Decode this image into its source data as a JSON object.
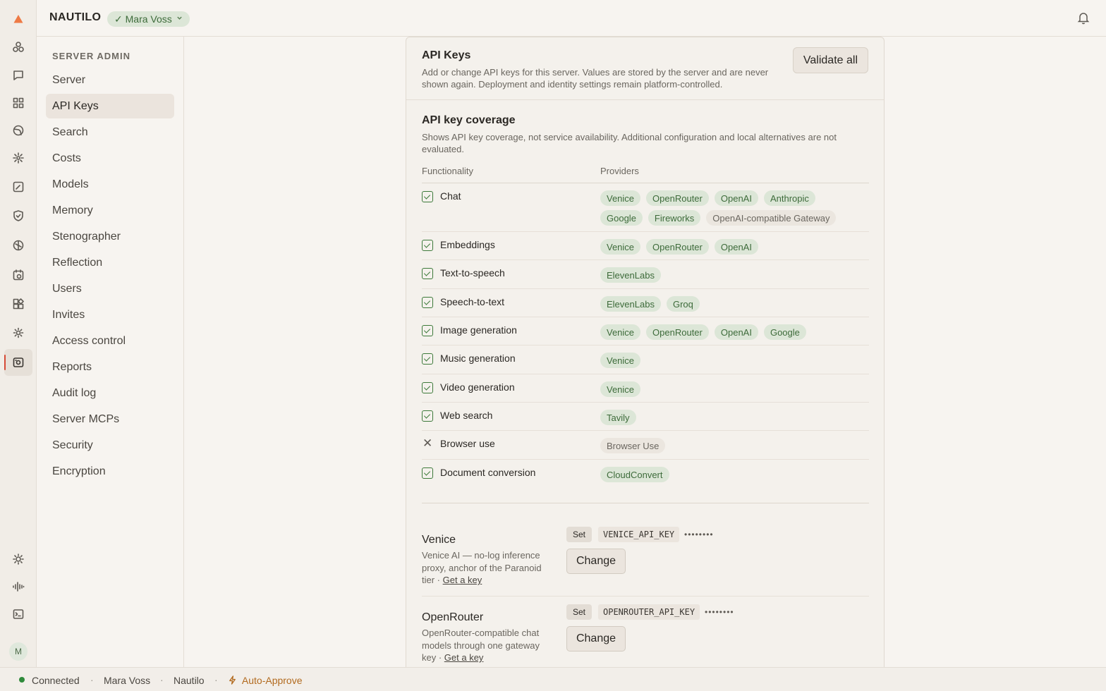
{
  "app": {
    "brand": "NAUTILO",
    "user_pill": "✓ Mara Voss",
    "avatar_initial": "M"
  },
  "rail_icons": [
    "logo-icon",
    "integrations-icon",
    "chat-icon",
    "apps-grid-icon",
    "globe-icon",
    "sparkle-icon",
    "edit-icon",
    "shield-icon",
    "brain-icon",
    "schedule-icon",
    "widgets-icon",
    "settings-icon",
    "server-admin-icon",
    "theme-icon",
    "audio-icon",
    "terminal-icon"
  ],
  "sidebar": {
    "title": "SERVER ADMIN",
    "items": [
      {
        "label": "Server"
      },
      {
        "label": "API Keys"
      },
      {
        "label": "Search"
      },
      {
        "label": "Costs"
      },
      {
        "label": "Models"
      },
      {
        "label": "Memory"
      },
      {
        "label": "Stenographer"
      },
      {
        "label": "Reflection"
      },
      {
        "label": "Users"
      },
      {
        "label": "Invites"
      },
      {
        "label": "Access control"
      },
      {
        "label": "Reports"
      },
      {
        "label": "Audit log"
      },
      {
        "label": "Server MCPs"
      },
      {
        "label": "Security"
      },
      {
        "label": "Encryption"
      }
    ],
    "active_index": 1
  },
  "panel": {
    "title": "API Keys",
    "description": "Add or change API keys for this server. Values are stored by the server and are never shown again. Deployment and identity settings remain platform-controlled.",
    "validate_label": "Validate all",
    "coverage_title": "API key coverage",
    "coverage_desc": "Shows API key coverage, not service availability. Additional configuration and local alternatives are not evaluated.",
    "col_functionality": "Functionality",
    "col_providers": "Providers",
    "rows": [
      {
        "name": "Chat",
        "covered": true,
        "providers": [
          {
            "n": "Venice",
            "on": true
          },
          {
            "n": "OpenRouter",
            "on": true
          },
          {
            "n": "OpenAI",
            "on": true
          },
          {
            "n": "Anthropic",
            "on": true
          },
          {
            "n": "Google",
            "on": true
          },
          {
            "n": "Fireworks",
            "on": true
          },
          {
            "n": "OpenAI-compatible Gateway",
            "on": false
          }
        ]
      },
      {
        "name": "Embeddings",
        "covered": true,
        "providers": [
          {
            "n": "Venice",
            "on": true
          },
          {
            "n": "OpenRouter",
            "on": true
          },
          {
            "n": "OpenAI",
            "on": true
          }
        ]
      },
      {
        "name": "Text-to-speech",
        "covered": true,
        "providers": [
          {
            "n": "ElevenLabs",
            "on": true
          }
        ]
      },
      {
        "name": "Speech-to-text",
        "covered": true,
        "providers": [
          {
            "n": "ElevenLabs",
            "on": true
          },
          {
            "n": "Groq",
            "on": true
          }
        ]
      },
      {
        "name": "Image generation",
        "covered": true,
        "providers": [
          {
            "n": "Venice",
            "on": true
          },
          {
            "n": "OpenRouter",
            "on": true
          },
          {
            "n": "OpenAI",
            "on": true
          },
          {
            "n": "Google",
            "on": true
          }
        ]
      },
      {
        "name": "Music generation",
        "covered": true,
        "providers": [
          {
            "n": "Venice",
            "on": true
          }
        ]
      },
      {
        "name": "Video generation",
        "covered": true,
        "providers": [
          {
            "n": "Venice",
            "on": true
          }
        ]
      },
      {
        "name": "Web search",
        "covered": true,
        "providers": [
          {
            "n": "Tavily",
            "on": true
          }
        ]
      },
      {
        "name": "Browser use",
        "covered": false,
        "providers": [
          {
            "n": "Browser Use",
            "on": false
          }
        ]
      },
      {
        "name": "Document conversion",
        "covered": true,
        "providers": [
          {
            "n": "CloudConvert",
            "on": true
          }
        ]
      }
    ],
    "keys": [
      {
        "name": "Venice",
        "description": "Venice AI — no-log inference proxy, anchor of the Paranoid tier · ",
        "link": "Get a key",
        "status": "Set",
        "env": "VENICE_API_KEY",
        "masked": "••••••••",
        "button": "Change"
      },
      {
        "name": "OpenRouter",
        "description": "OpenRouter-compatible chat models through one gateway key · ",
        "link": "Get a key",
        "status": "Set",
        "env": "OPENROUTER_API_KEY",
        "masked": "••••••••",
        "button": "Change"
      }
    ]
  },
  "status": {
    "connection": "Connected",
    "user": "Mara Voss",
    "workspace": "Nautilo",
    "mode": "Auto-Approve",
    "separator": "·"
  }
}
